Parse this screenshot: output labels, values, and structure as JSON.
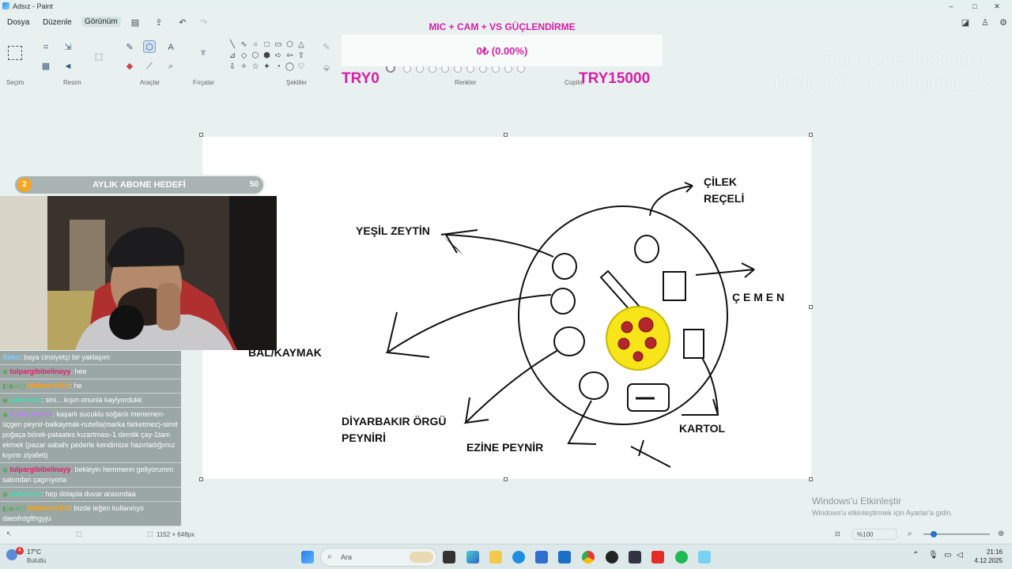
{
  "window": {
    "title": "Adsız - Paint",
    "controls": [
      "–",
      "□",
      "✕"
    ]
  },
  "menu": {
    "items": [
      "Dosya",
      "Düzenle",
      "Görünüm"
    ]
  },
  "ribbon": {
    "groups": [
      "Seçim",
      "Resim",
      "Araçlar",
      "Fırçalar",
      "Şekiller",
      "Renkler",
      "Copilot"
    ],
    "tools": {
      "pencil": "✎",
      "fill": "⬤",
      "text": "A",
      "eraser": "⌫",
      "picker": "⌖",
      "zoom": "⌕"
    },
    "shape_symbols": [
      "╲",
      "∿",
      "○",
      "□",
      "▭",
      "⬠",
      "△",
      "⊿",
      "◇",
      "⬡",
      "⬢",
      "➪",
      "⇦",
      "⇧",
      "⇩",
      "✧",
      "☆",
      "✦",
      "◔",
      "◯",
      "♡"
    ]
  },
  "overlay": {
    "goal_title": "MIC + CAM + VS GÜÇLENDİRME",
    "goal_amount": "0₺ (0.00%)",
    "goal_min": "TRY0",
    "goal_max": "TRY15000",
    "ghost_line1": "Son abone: furnanturu",
    "ghost_line2": "Hediye Abone: MehmetKEN"
  },
  "sub_goal": {
    "count": "2",
    "title": "AYLIK ABONE HEDEFİ",
    "target": "50"
  },
  "drawing_labels": {
    "cilek": "ÇİLEK\nREÇELİ",
    "zeytin": "YEŞİL ZEYTİN",
    "cemen": "Ç E M E N",
    "bal": "BAL/KAYMAK",
    "orgu": "DİYARBAKIR ÖRGÜ\nPEYNİRİ",
    "ezine": "EZİNE PEYNİR",
    "kartol": "KARTOL"
  },
  "chat": [
    {
      "user": "Xdeo",
      "color": "#7fd0ff",
      "badges": "",
      "text": ": baya cinsiyetçi bir yaklaşım"
    },
    {
      "user": "tulpargibibelinayy",
      "color": "#e8196a",
      "badges": "◉",
      "text": ": hee"
    },
    {
      "user": "MehmetKBN",
      "color": "#f7a21b",
      "badges": "◧◉①◫",
      "text": ": he"
    },
    {
      "user": "safisinizz",
      "color": "#3fe0b0",
      "badges": "◉",
      "text": ": sini... kışın onunla kaylyordukk"
    },
    {
      "user": "furan_online",
      "color": "#c07cff",
      "badges": "◉",
      "text": ": kaşarlı sucuklu soğanlı menemen-üçgen peynir-balkaymak-nutella(marka farketmez)-simit poğaça börek-pataates kızartması-1 demlik çay-1tam ekmek (pazar sabahı pederle kendimize hazırladığımız kıyıntı ziyafeti)"
    },
    {
      "user": "tulpargibibelinayy",
      "color": "#e8196a",
      "badges": "◉",
      "text": ": bekleyin hemmenn geliyorumm salondan çagırıyorla"
    },
    {
      "user": "safisinizz",
      "color": "#3fe0b0",
      "badges": "◉",
      "text": ": hep dolapla duvar arasındaa"
    },
    {
      "user": "MehmetKBN",
      "color": "#f7a21b",
      "badges": "◧◉①◫",
      "text": ": bizde leğen kullanılıyo daesfrdgfthgyju"
    }
  ],
  "status": {
    "canvas_size": "1152 × 648px",
    "zoom": "%100",
    "activate_title": "Windows'u Etkinleştir",
    "activate_sub": "Windows'u etkinleştirmek için Ayarlar'a gidin."
  },
  "taskbar": {
    "weather_temp": "17°C",
    "weather_desc": "Bulutlu",
    "weather_badge": "4",
    "search_placeholder": "Ara",
    "time": "21:16",
    "date": "4.12.2025"
  },
  "colors": {
    "accent_pink": "#d81ea8",
    "canvas": "#ffffff",
    "app_bg": "#e8f1ef"
  }
}
